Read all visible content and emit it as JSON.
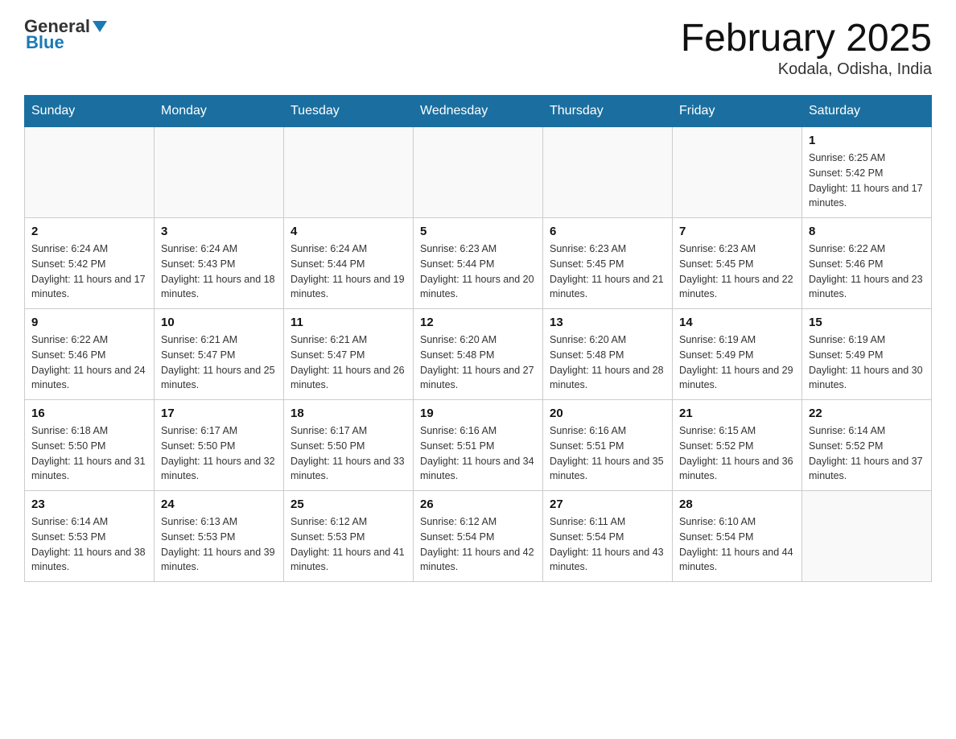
{
  "logo": {
    "general": "General",
    "blue": "Blue"
  },
  "title": {
    "month": "February 2025",
    "location": "Kodala, Odisha, India"
  },
  "weekdays": [
    "Sunday",
    "Monday",
    "Tuesday",
    "Wednesday",
    "Thursday",
    "Friday",
    "Saturday"
  ],
  "weeks": [
    [
      {
        "day": "",
        "info": ""
      },
      {
        "day": "",
        "info": ""
      },
      {
        "day": "",
        "info": ""
      },
      {
        "day": "",
        "info": ""
      },
      {
        "day": "",
        "info": ""
      },
      {
        "day": "",
        "info": ""
      },
      {
        "day": "1",
        "info": "Sunrise: 6:25 AM\nSunset: 5:42 PM\nDaylight: 11 hours and 17 minutes."
      }
    ],
    [
      {
        "day": "2",
        "info": "Sunrise: 6:24 AM\nSunset: 5:42 PM\nDaylight: 11 hours and 17 minutes."
      },
      {
        "day": "3",
        "info": "Sunrise: 6:24 AM\nSunset: 5:43 PM\nDaylight: 11 hours and 18 minutes."
      },
      {
        "day": "4",
        "info": "Sunrise: 6:24 AM\nSunset: 5:44 PM\nDaylight: 11 hours and 19 minutes."
      },
      {
        "day": "5",
        "info": "Sunrise: 6:23 AM\nSunset: 5:44 PM\nDaylight: 11 hours and 20 minutes."
      },
      {
        "day": "6",
        "info": "Sunrise: 6:23 AM\nSunset: 5:45 PM\nDaylight: 11 hours and 21 minutes."
      },
      {
        "day": "7",
        "info": "Sunrise: 6:23 AM\nSunset: 5:45 PM\nDaylight: 11 hours and 22 minutes."
      },
      {
        "day": "8",
        "info": "Sunrise: 6:22 AM\nSunset: 5:46 PM\nDaylight: 11 hours and 23 minutes."
      }
    ],
    [
      {
        "day": "9",
        "info": "Sunrise: 6:22 AM\nSunset: 5:46 PM\nDaylight: 11 hours and 24 minutes."
      },
      {
        "day": "10",
        "info": "Sunrise: 6:21 AM\nSunset: 5:47 PM\nDaylight: 11 hours and 25 minutes."
      },
      {
        "day": "11",
        "info": "Sunrise: 6:21 AM\nSunset: 5:47 PM\nDaylight: 11 hours and 26 minutes."
      },
      {
        "day": "12",
        "info": "Sunrise: 6:20 AM\nSunset: 5:48 PM\nDaylight: 11 hours and 27 minutes."
      },
      {
        "day": "13",
        "info": "Sunrise: 6:20 AM\nSunset: 5:48 PM\nDaylight: 11 hours and 28 minutes."
      },
      {
        "day": "14",
        "info": "Sunrise: 6:19 AM\nSunset: 5:49 PM\nDaylight: 11 hours and 29 minutes."
      },
      {
        "day": "15",
        "info": "Sunrise: 6:19 AM\nSunset: 5:49 PM\nDaylight: 11 hours and 30 minutes."
      }
    ],
    [
      {
        "day": "16",
        "info": "Sunrise: 6:18 AM\nSunset: 5:50 PM\nDaylight: 11 hours and 31 minutes."
      },
      {
        "day": "17",
        "info": "Sunrise: 6:17 AM\nSunset: 5:50 PM\nDaylight: 11 hours and 32 minutes."
      },
      {
        "day": "18",
        "info": "Sunrise: 6:17 AM\nSunset: 5:50 PM\nDaylight: 11 hours and 33 minutes."
      },
      {
        "day": "19",
        "info": "Sunrise: 6:16 AM\nSunset: 5:51 PM\nDaylight: 11 hours and 34 minutes."
      },
      {
        "day": "20",
        "info": "Sunrise: 6:16 AM\nSunset: 5:51 PM\nDaylight: 11 hours and 35 minutes."
      },
      {
        "day": "21",
        "info": "Sunrise: 6:15 AM\nSunset: 5:52 PM\nDaylight: 11 hours and 36 minutes."
      },
      {
        "day": "22",
        "info": "Sunrise: 6:14 AM\nSunset: 5:52 PM\nDaylight: 11 hours and 37 minutes."
      }
    ],
    [
      {
        "day": "23",
        "info": "Sunrise: 6:14 AM\nSunset: 5:53 PM\nDaylight: 11 hours and 38 minutes."
      },
      {
        "day": "24",
        "info": "Sunrise: 6:13 AM\nSunset: 5:53 PM\nDaylight: 11 hours and 39 minutes."
      },
      {
        "day": "25",
        "info": "Sunrise: 6:12 AM\nSunset: 5:53 PM\nDaylight: 11 hours and 41 minutes."
      },
      {
        "day": "26",
        "info": "Sunrise: 6:12 AM\nSunset: 5:54 PM\nDaylight: 11 hours and 42 minutes."
      },
      {
        "day": "27",
        "info": "Sunrise: 6:11 AM\nSunset: 5:54 PM\nDaylight: 11 hours and 43 minutes."
      },
      {
        "day": "28",
        "info": "Sunrise: 6:10 AM\nSunset: 5:54 PM\nDaylight: 11 hours and 44 minutes."
      },
      {
        "day": "",
        "info": ""
      }
    ]
  ]
}
